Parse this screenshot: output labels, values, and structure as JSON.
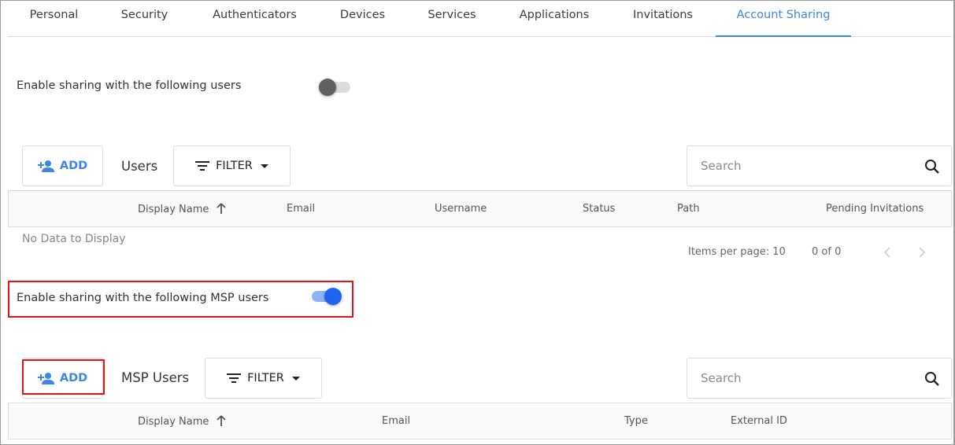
{
  "tabs": [
    "Personal",
    "Security",
    "Authenticators",
    "Devices",
    "Services",
    "Applications",
    "Invitations",
    "Account Sharing"
  ],
  "active_tab": "Account Sharing",
  "users_section": {
    "toggle_label": "Enable sharing with the following users",
    "toggle_on": false,
    "add_label": "ADD",
    "title": "Users",
    "filter_label": "FILTER",
    "search_placeholder": "Search",
    "columns": [
      "Display Name",
      "Email",
      "Username",
      "Status",
      "Path",
      "Pending Invitations"
    ],
    "empty_text": "No Data to Display",
    "items_per_page_label": "Items per page: 10",
    "range_label": "0 of 0"
  },
  "msp_section": {
    "toggle_label": "Enable sharing with the following MSP users",
    "toggle_on": true,
    "add_label": "ADD",
    "title": "MSP Users",
    "filter_label": "FILTER",
    "search_placeholder": "Search",
    "columns": [
      "Display Name",
      "Email",
      "Type",
      "External ID"
    ]
  },
  "colors": {
    "accent": "#3b86e6",
    "toggle_on": "#1f63f0",
    "highlight": "#e0141b"
  },
  "icons": {
    "add": "person-add-icon",
    "filter": "filter-lines-icon",
    "caret": "caret-down-icon",
    "search": "search-icon",
    "sort": "arrow-up-icon",
    "prev": "chevron-left-icon",
    "next": "chevron-right-icon"
  }
}
